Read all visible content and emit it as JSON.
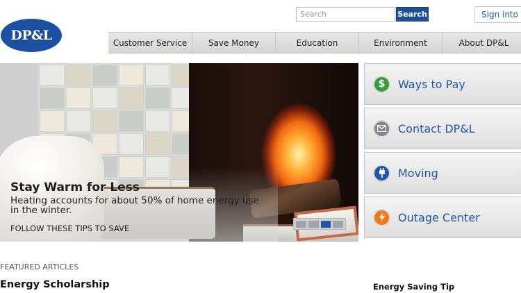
{
  "header": {
    "logo_text": "DP&L",
    "search": {
      "placeholder": "Search",
      "button_label": "Search"
    },
    "signin_label": "Sign into eBill"
  },
  "nav": {
    "items": [
      "Customer Service",
      "Save Money",
      "Education",
      "Environment",
      "About DP&L"
    ]
  },
  "hero": {
    "title": "Stay Warm for Less",
    "body": "Heating accounts for about 50% of home energy use in the winter.",
    "cta": "FOLLOW THESE TIPS TO SAVE",
    "slides_total": 4,
    "active_slide": 3
  },
  "side_links": [
    {
      "label": "Ways to Pay",
      "icon": "dollar-icon"
    },
    {
      "label": "Contact DP&L",
      "icon": "mail-icon"
    },
    {
      "label": "Moving",
      "icon": "plug-icon"
    },
    {
      "label": "Outage Center",
      "icon": "lightning-icon"
    }
  ],
  "featured": {
    "heading": "FEATURED ARTICLES",
    "article_title": "Energy Scholarship"
  },
  "tip": {
    "title": "Energy Saving Tip"
  },
  "colors": {
    "brand_blue": "#1b4fa0",
    "link_blue": "#1f57a8",
    "dollar_green": "#3a9b3a",
    "outage_orange": "#ee7b18"
  }
}
